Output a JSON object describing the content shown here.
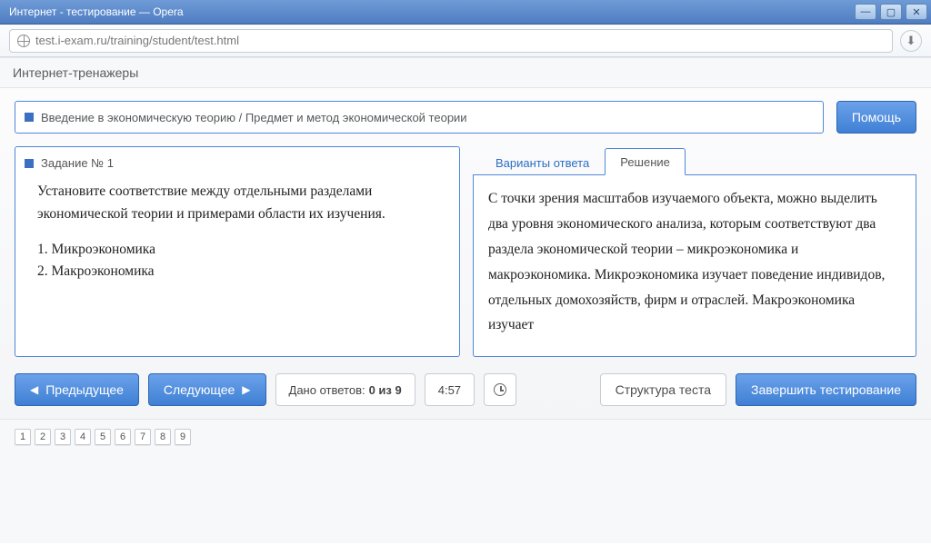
{
  "window": {
    "title": "Интернет - тестирование — Opera"
  },
  "address": {
    "url": "test.i-exam.ru/training/student/test.html"
  },
  "page": {
    "heading": "Интернет-тренажеры"
  },
  "topic": {
    "text": "Введение в экономическую теорию / Предмет и метод экономической теории"
  },
  "help_btn": "Помощь",
  "task": {
    "label": "Задание № 1",
    "prompt": "Установите соответствие между отдельными разделами экономической теории и примерами области их изучения.",
    "items": [
      "1. Микроэкономика",
      "2. Макроэкономика"
    ]
  },
  "tabs": {
    "answers": "Варианты ответа",
    "solution": "Решение",
    "active": "solution"
  },
  "solution_text": "С точки зрения масштабов изучаемого объекта, можно выделить два уровня экономического анализа, которым соответствуют два раздела экономической теории – микроэкономика и макроэкономика. Микроэкономика изучает поведение индивидов, отдельных домохозяйств, фирм и отраслей. Макроэкономика изучает",
  "nav": {
    "prev": "Предыдущее",
    "next": "Следующее",
    "answered_label": "Дано ответов:",
    "answered_value": "0 из 9",
    "timer": "4:57",
    "structure": "Структура теста",
    "finish": "Завершить тестирование"
  },
  "questions": [
    "1",
    "2",
    "3",
    "4",
    "5",
    "6",
    "7",
    "8",
    "9"
  ]
}
